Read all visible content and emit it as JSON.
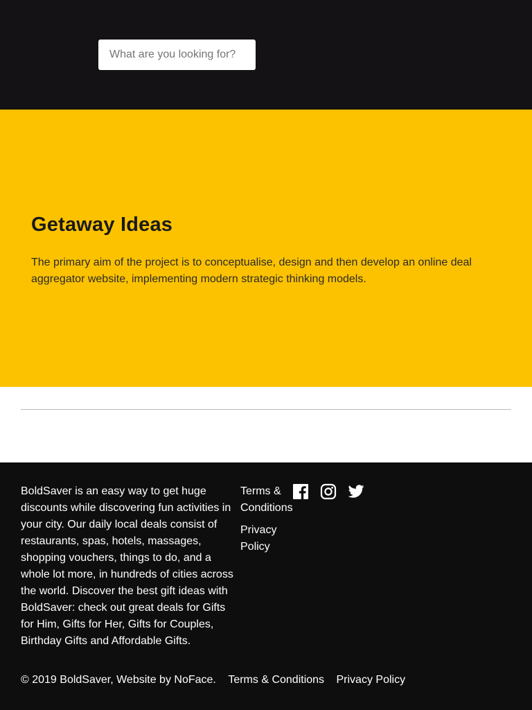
{
  "search": {
    "placeholder": "What are you looking for?"
  },
  "hero": {
    "title": "Getaway Ideas",
    "description": "The primary aim of the project is to conceptualise, design and then develop an online deal aggregator website, implementing modern strategic thinking models."
  },
  "footer": {
    "about": "BoldSaver is an easy way to get huge discounts while discovering fun activities in your city. Our daily local deals consist of restaurants, spas, hotels, massages, shopping vouchers, things to do, and a whole lot more, in hundreds of cities across the world. Discover the best gift ideas with BoldSaver: check out great deals for Gifts for Him, Gifts for Her, Gifts for Couples, Birthday Gifts and Affordable Gifts.",
    "links": {
      "terms": "Terms & Conditions",
      "privacy": "Privacy Policy"
    },
    "social": [
      "facebook-icon",
      "instagram-icon",
      "twitter-icon"
    ],
    "bottom": {
      "copyright": "© 2019 BoldSaver, Website by NoFace.",
      "terms": "Terms & Conditions",
      "privacy": "Privacy Policy"
    }
  },
  "colors": {
    "header_bg": "#141214",
    "hero_bg": "#fcc200",
    "footer_bg": "#0e0e0e",
    "text_light": "#ffffff"
  }
}
